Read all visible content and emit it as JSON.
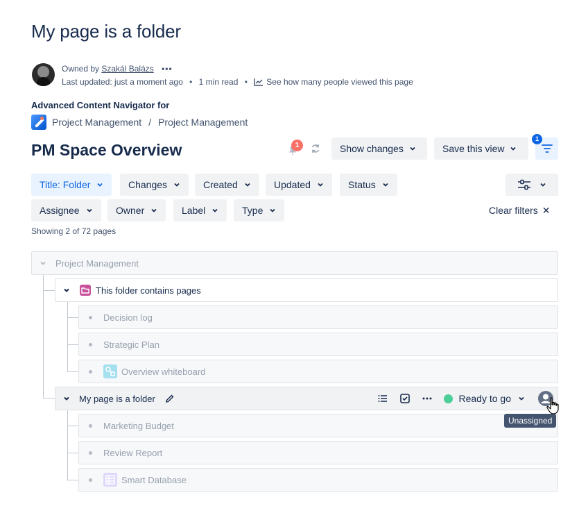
{
  "page": {
    "title": "My page is a folder",
    "owned_prefix": "Owned by",
    "owner": "Szakál Balázs",
    "more_label": "•••",
    "last_updated": "Last updated: just a moment ago",
    "read_time": "1 min read",
    "analytics": "See how many people viewed this page",
    "separator": "•"
  },
  "macro": {
    "label": "Advanced Content Navigator for",
    "breadcrumb": [
      "Project Management",
      "Project Management"
    ],
    "breadcrumb_sep": "/",
    "section_title": "PM Space Overview",
    "notification_count": "1",
    "show_changes": "Show changes",
    "save_view": "Save this view",
    "filter_count": "1"
  },
  "filters": {
    "row1": [
      "Title: Folder",
      "Changes",
      "Created",
      "Updated",
      "Status"
    ],
    "row2": [
      "Assignee",
      "Owner",
      "Label",
      "Type"
    ],
    "clear": "Clear filters",
    "clear_icon": "✕",
    "showing": "Showing 2 of 72 pages"
  },
  "tree": {
    "root": "Project Management",
    "folder": "This folder contains pages",
    "folder_children": [
      "Decision log",
      "Strategic Plan",
      "Overview whiteboard"
    ],
    "page": "My page is a folder",
    "page_status": "Ready to go",
    "page_children": [
      "Marketing Budget",
      "Review Report",
      "Smart Database"
    ]
  },
  "tooltip": "Unassigned",
  "colors": {
    "accent": "#0c66e4",
    "status_green": "#4bce97",
    "badge_red": "#f87168",
    "folder_pink": "#c9519c"
  },
  "icons": [
    "analytics-icon",
    "pin-icon",
    "refresh-icon",
    "filter-icon",
    "chevron-down-icon",
    "settings-sliders-icon",
    "close-icon",
    "folder-icon",
    "whiteboard-icon",
    "database-icon",
    "edit-icon",
    "list-icon",
    "checkbox-icon",
    "more-icon",
    "avatar-icon",
    "hand-cursor-icon"
  ]
}
